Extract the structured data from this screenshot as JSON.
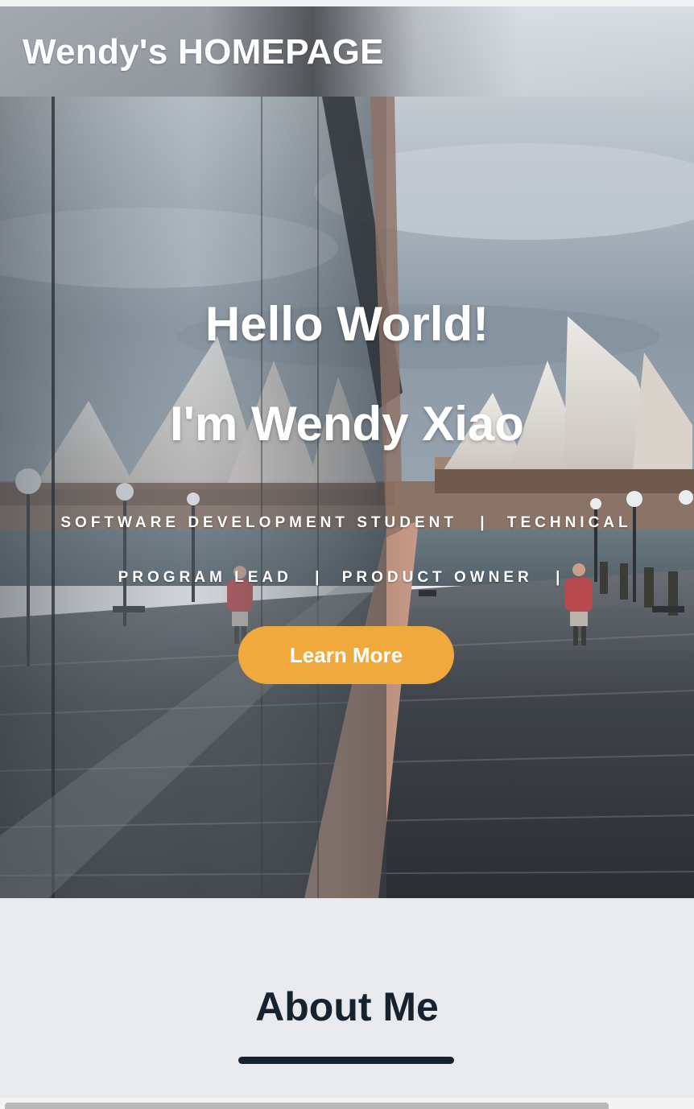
{
  "header": {
    "brand": "Wendy's HOMEPAGE"
  },
  "hero": {
    "greeting": "Hello World!",
    "intro": "I'm Wendy Xiao",
    "roles": [
      "SOFTWARE DEVELOPMENT STUDENT",
      "TECHNICAL PROGRAM LEAD",
      "PRODUCT OWNER"
    ],
    "role_separator": "|",
    "cta_label": "Learn More"
  },
  "about": {
    "title": "About Me"
  },
  "colors": {
    "accent": "#f0a93c",
    "dark": "#17222f",
    "section_bg": "#e8eaed",
    "text_light": "#ffffff"
  }
}
